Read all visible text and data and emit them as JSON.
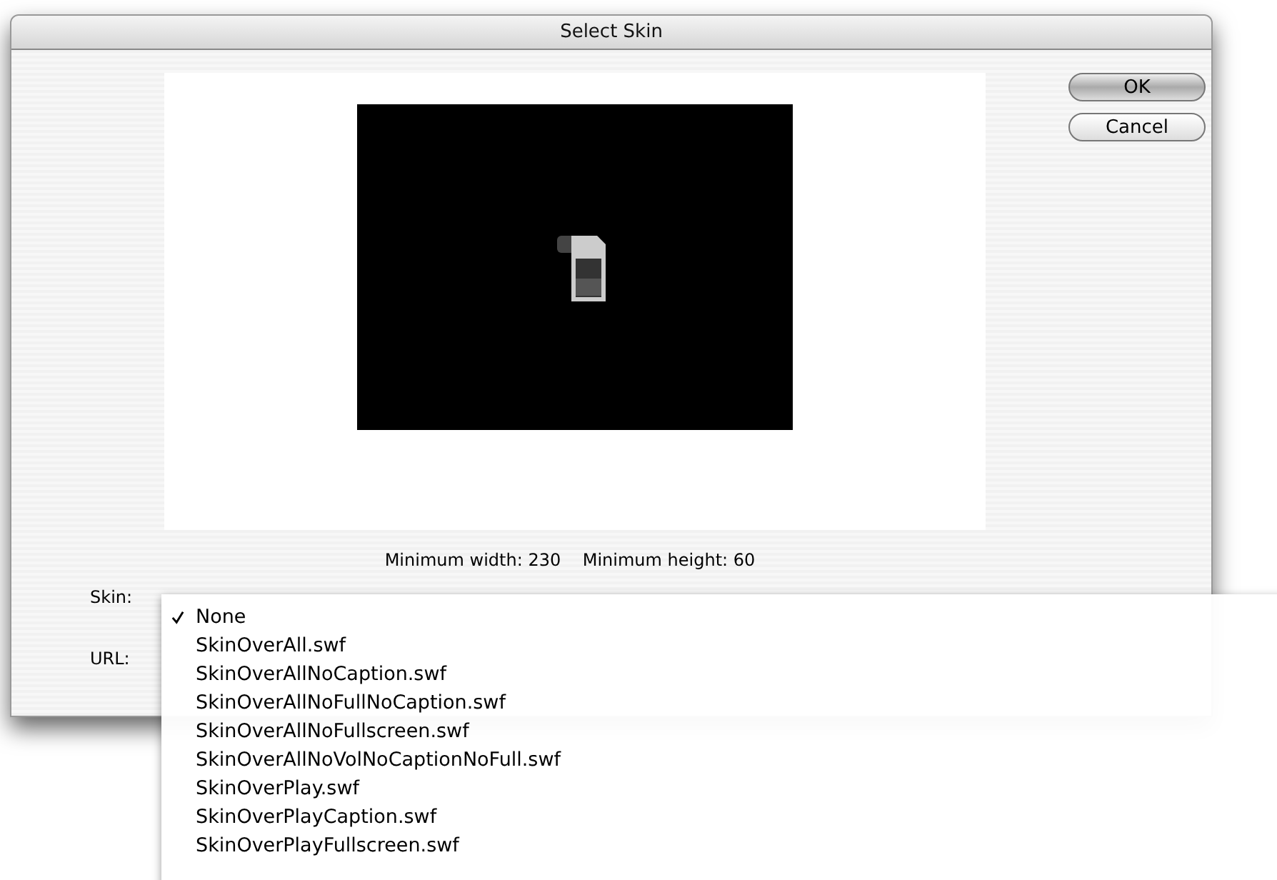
{
  "window": {
    "title": "Select Skin"
  },
  "buttons": [
    {
      "label": "OK",
      "default": true
    },
    {
      "label": "Cancel",
      "default": false
    }
  ],
  "minimum_text": "Minimum width: 230    Minimum height: 60",
  "fields": [
    {
      "label": "Skin:"
    },
    {
      "label": "URL:"
    }
  ],
  "menu": {
    "items": [
      {
        "label": "None",
        "selected": true
      },
      {
        "label": "SkinOverAll.swf",
        "selected": false
      },
      {
        "label": "SkinOverAllNoCaption.swf",
        "selected": false
      },
      {
        "label": "SkinOverAllNoFullNoCaption.swf",
        "selected": false
      },
      {
        "label": "SkinOverAllNoFullscreen.swf",
        "selected": false
      },
      {
        "label": "SkinOverAllNoVolNoCaptionNoFull.swf",
        "selected": false
      },
      {
        "label": "SkinOverPlay.swf",
        "selected": false
      },
      {
        "label": "SkinOverPlayCaption.swf",
        "selected": false
      },
      {
        "label": "SkinOverPlayFullscreen.swf",
        "selected": false
      }
    ]
  }
}
